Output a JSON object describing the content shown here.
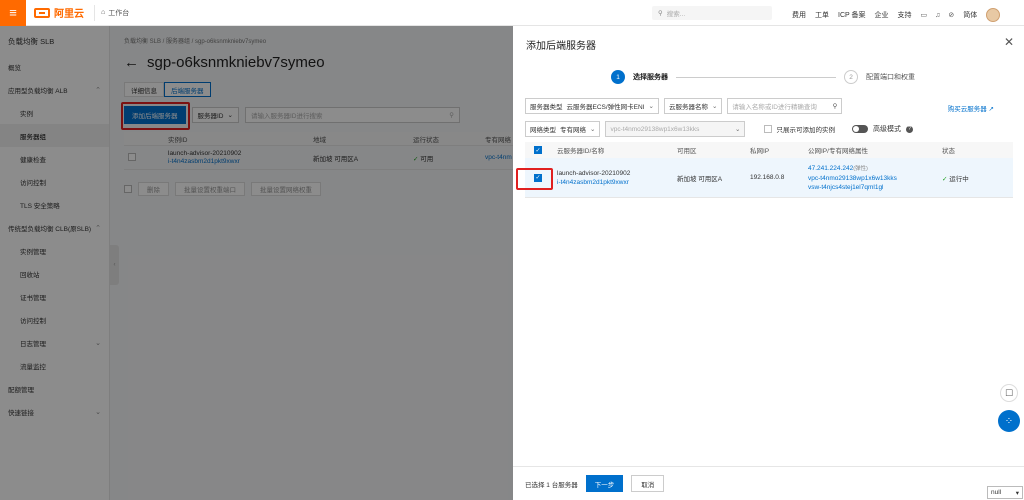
{
  "topbar": {
    "brand": "阿里云",
    "workbench": "工作台",
    "search_placeholder": "搜索...",
    "links": [
      "费用",
      "工单",
      "ICP 备案",
      "企业",
      "支持"
    ],
    "lang": "简体"
  },
  "sidebar": {
    "title": "负载均衡 SLB",
    "items": [
      {
        "label": "概览",
        "sub": false,
        "active": false,
        "chevron": ""
      },
      {
        "label": "应用型负载均衡 ALB",
        "sub": false,
        "active": false,
        "chevron": "^"
      },
      {
        "label": "实例",
        "sub": true,
        "active": false,
        "chevron": ""
      },
      {
        "label": "服务器组",
        "sub": true,
        "active": true,
        "chevron": ""
      },
      {
        "label": "健康检查",
        "sub": true,
        "active": false,
        "chevron": ""
      },
      {
        "label": "访问控制",
        "sub": true,
        "active": false,
        "chevron": ""
      },
      {
        "label": "TLS 安全策略",
        "sub": true,
        "active": false,
        "chevron": ""
      },
      {
        "label": "传统型负载均衡 CLB(原SLB)",
        "sub": false,
        "active": false,
        "chevron": "^"
      },
      {
        "label": "实例管理",
        "sub": true,
        "active": false,
        "chevron": ""
      },
      {
        "label": "回收站",
        "sub": true,
        "active": false,
        "chevron": ""
      },
      {
        "label": "证书管理",
        "sub": true,
        "active": false,
        "chevron": ""
      },
      {
        "label": "访问控制",
        "sub": true,
        "active": false,
        "chevron": ""
      },
      {
        "label": "日志管理",
        "sub": true,
        "active": false,
        "chevron": "v"
      },
      {
        "label": "流量监控",
        "sub": true,
        "active": false,
        "chevron": ""
      },
      {
        "label": "配额管理",
        "sub": false,
        "active": false,
        "chevron": ""
      },
      {
        "label": "快速链接",
        "sub": false,
        "active": false,
        "chevron": "v"
      }
    ]
  },
  "main": {
    "breadcrumb": "负载均衡 SLB  /  服务器组  /  sgp-o6ksnmkniebv7symeo",
    "title": "sgp-o6ksnmkniebv7symeo",
    "tabs": [
      "详细信息",
      "后端服务器"
    ],
    "add_button": "添加后端服务器",
    "filter_select": "服务器ID",
    "filter_placeholder": "请输入服务器ID进行搜索",
    "table_headers": [
      "实例ID",
      "地域",
      "运行状态",
      "专有网络"
    ],
    "row": {
      "name": "launch-advisor-20210902",
      "id": "i-t4n4zasbm2d1pkt9xwxr",
      "zone": "新加坡 可用区A",
      "status": "可用",
      "vpc": "vpc-t4nm"
    },
    "actions": [
      "删除",
      "批量设置权重端口",
      "批量设置网络权重"
    ]
  },
  "drawer": {
    "title": "添加后端服务器",
    "step1_num": "1",
    "step1_label": "选择服务器",
    "step2_num": "2",
    "step2_label": "配置端口和权重",
    "server_type_label": "服务器类型",
    "server_type_value": "云服务器ECS/弹性网卡ENI",
    "name_select": "云服务器名称",
    "search_placeholder": "请输入名称或ID进行精确查询",
    "buy_link": "购买云服务器",
    "net_type_label": "网络类型",
    "net_type_value": "专有网络",
    "vpc_value": "vpc-t4nmo29138wp1x6w13kks",
    "only_addable": "只展示可添加的实例",
    "advanced": "高级模式",
    "headers": [
      "云服务器ID/名称",
      "可用区",
      "私网IP",
      "公网IP/专有网络属性",
      "状态"
    ],
    "row": {
      "name": "launch-advisor-20210902",
      "id": "i-t4n4zasbm2d1pkt9xwxr",
      "zone": "新加坡 可用区A",
      "private_ip": "192.168.0.8",
      "public_ip": "47.241.224.242",
      "public_ip_note": "(弹性)",
      "vpc": "vpc-t4nmo29138wp1x6w13kks",
      "vsw": "vsw-t4njcs4stej1el7qml1gl",
      "status": "运行中"
    },
    "footer_selected": "已选择 1 台服务器",
    "next_button": "下一步",
    "cancel_button": "取消"
  },
  "corner": {
    "value": "null"
  },
  "colors": {
    "brand": "#ff6a00",
    "primary": "#0070cc",
    "highlight": "#e02020",
    "success": "#1fa11f"
  }
}
